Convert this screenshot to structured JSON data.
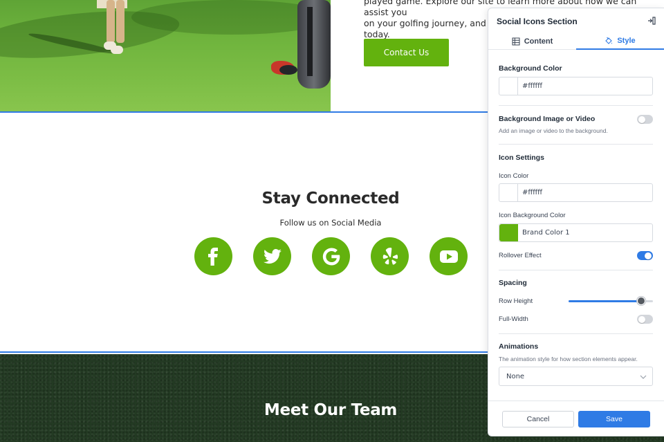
{
  "hero": {
    "text_lines": [
      "played game. Explore our site to learn more about how we can assist you",
      "on your golfing journey, and join th",
      "today."
    ],
    "contact_button": "Contact Us"
  },
  "social_section": {
    "title": "Stay Connected",
    "subtitle": "Follow us on Social Media",
    "icons": [
      "facebook-icon",
      "twitter-icon",
      "google-icon",
      "yelp-icon",
      "youtube-icon"
    ],
    "icon_color": "#63b20e"
  },
  "team_section": {
    "title": "Meet Our Team"
  },
  "panel": {
    "title": "Social Icons Section",
    "tabs": [
      {
        "label": "Content",
        "active": false
      },
      {
        "label": "Style",
        "active": true
      }
    ],
    "background_color": {
      "label": "Background Color",
      "value": "#ffffff"
    },
    "background_media": {
      "label": "Background Image or Video",
      "hint": "Add an image or video to the background.",
      "enabled": false
    },
    "icon_settings": {
      "heading": "Icon Settings",
      "icon_color_label": "Icon Color",
      "icon_color_value": "#ffffff",
      "icon_bg_label": "Icon Background Color",
      "icon_bg_value": "Brand Color 1",
      "rollover_label": "Rollover Effect",
      "rollover_enabled": true
    },
    "spacing": {
      "heading": "Spacing",
      "row_height_label": "Row Height",
      "row_height_value": 0.86,
      "full_width_label": "Full-Width",
      "full_width_enabled": false
    },
    "animations": {
      "heading": "Animations",
      "hint": "The animation style for how section elements appear.",
      "value": "None"
    },
    "cancel_label": "Cancel",
    "save_label": "Save"
  },
  "colors": {
    "accent_blue": "#2f7be5",
    "brand_green": "#63b20e"
  }
}
